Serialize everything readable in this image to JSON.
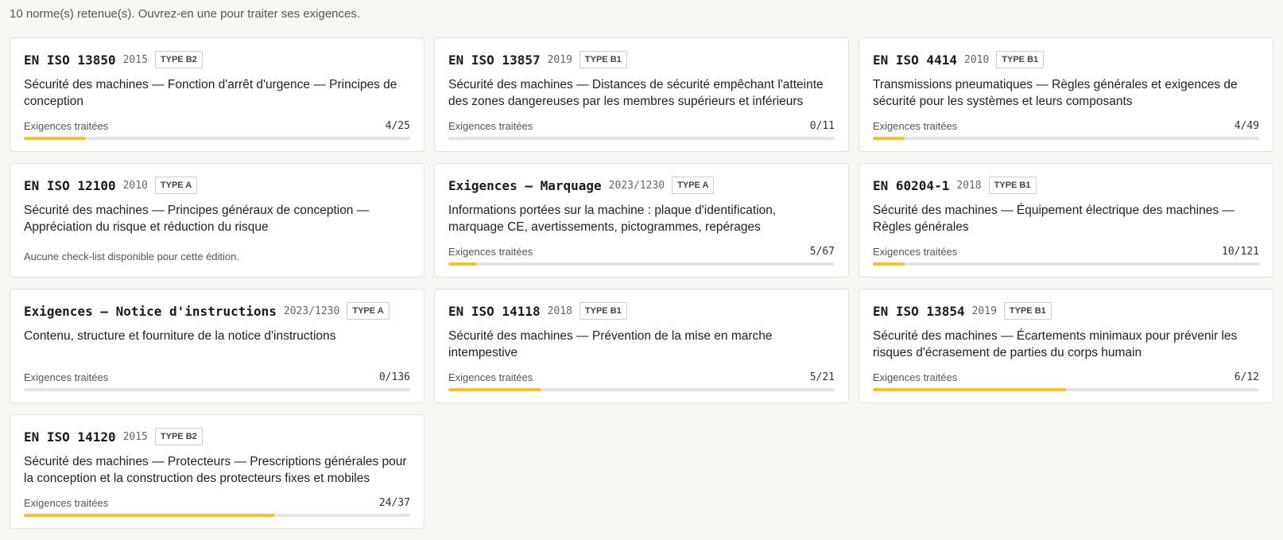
{
  "intro": "10 norme(s) retenue(s). Ouvrez-en une pour traiter ses exigences.",
  "progress_label": "Exigences traitées",
  "accent_color": "#f2c12e",
  "cards": [
    {
      "code": "EN ISO 13850",
      "year": "2015",
      "type": "TYPE B2",
      "title": "Sécurité des machines — Fonction d'arrêt d'urgence — Principes de conception",
      "done": 4,
      "total": 25,
      "count": "4/25"
    },
    {
      "code": "EN ISO 13857",
      "year": "2019",
      "type": "TYPE B1",
      "title": "Sécurité des machines — Distances de sécurité empêchant l'atteinte des zones dangereuses par les membres supérieurs et inférieurs",
      "done": 0,
      "total": 11,
      "count": "0/11"
    },
    {
      "code": "EN ISO 4414",
      "year": "2010",
      "type": "TYPE B1",
      "title": "Transmissions pneumatiques — Règles générales et exigences de sécurité pour les systèmes et leurs composants",
      "done": 4,
      "total": 49,
      "count": "4/49"
    },
    {
      "code": "EN ISO 12100",
      "year": "2010",
      "type": "TYPE A",
      "title": "Sécurité des machines — Principes généraux de conception — Appréciation du risque et réduction du risque",
      "no_checklist": "Aucune check-list disponible pour cette édition."
    },
    {
      "code": "Exigences — Marquage",
      "year": "2023/1230",
      "type": "TYPE A",
      "title": "Informations portées sur la machine : plaque d'identification, marquage CE, avertissements, pictogrammes, repérages",
      "done": 5,
      "total": 67,
      "count": "5/67"
    },
    {
      "code": "EN 60204-1",
      "year": "2018",
      "type": "TYPE B1",
      "title": "Sécurité des machines — Équipement électrique des machines — Règles générales",
      "done": 10,
      "total": 121,
      "count": "10/121"
    },
    {
      "code": "Exigences — Notice d'instructions",
      "year": "2023/1230",
      "type": "TYPE A",
      "title": "Contenu, structure et fourniture de la notice d'instructions",
      "done": 0,
      "total": 136,
      "count": "0/136"
    },
    {
      "code": "EN ISO 14118",
      "year": "2018",
      "type": "TYPE B1",
      "title": "Sécurité des machines — Prévention de la mise en marche intempestive",
      "done": 5,
      "total": 21,
      "count": "5/21"
    },
    {
      "code": "EN ISO 13854",
      "year": "2019",
      "type": "TYPE B1",
      "title": "Sécurité des machines — Écartements minimaux pour prévenir les risques d'écrasement de parties du corps humain",
      "done": 6,
      "total": 12,
      "count": "6/12"
    },
    {
      "code": "EN ISO 14120",
      "year": "2015",
      "type": "TYPE B2",
      "title": "Sécurité des machines — Protecteurs — Prescriptions générales pour la conception et la construction des protecteurs fixes et mobiles",
      "done": 24,
      "total": 37,
      "count": "24/37"
    }
  ]
}
